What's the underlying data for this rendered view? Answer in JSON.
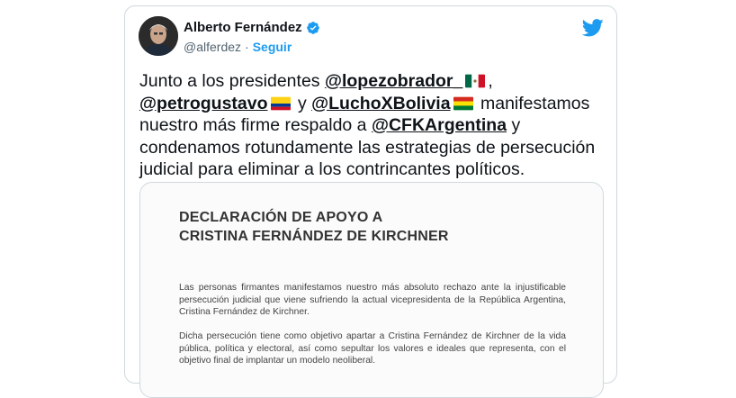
{
  "author": {
    "name": "Alberto Fernández",
    "handle": "@alferdez",
    "separator": "·",
    "follow_label": "Seguir"
  },
  "icons": {
    "verified": "verified-badge-icon",
    "brand": "twitter-bird-icon"
  },
  "colors": {
    "accent": "#1d9bf0",
    "text": "#0f1419",
    "muted": "#536471",
    "border": "#cfd9de"
  },
  "tweet": {
    "t1": "Junto a los presidentes ",
    "m1": "@lopezobrador_",
    "t2": ",",
    "m2": "@petrogustavo",
    "t3": " y ",
    "m3": "@LuchoXBolivia",
    "t4": " manifestamos nuestro más firme respaldo a ",
    "m4": "@CFKArgentina",
    "t5": " y condenamos rotundamente las estrategias de persecución judicial para eliminar a los contrincantes políticos."
  },
  "document": {
    "title_line1": "DECLARACIÓN DE APOYO A",
    "title_line2": "CRISTINA FERNÁNDEZ DE KIRCHNER",
    "p1": "Las personas firmantes manifestamos nuestro más absoluto rechazo ante la injustificable persecución judicial que viene sufriendo la actual vicepresidenta de la República Argentina, Cristina Fernández de Kirchner.",
    "p2": "Dicha persecución tiene como objetivo apartar a Cristina Fernández de Kirchner de la vida pública, política y electoral, así como sepultar los valores e ideales que representa, con el objetivo final de implantar un modelo neoliberal."
  }
}
